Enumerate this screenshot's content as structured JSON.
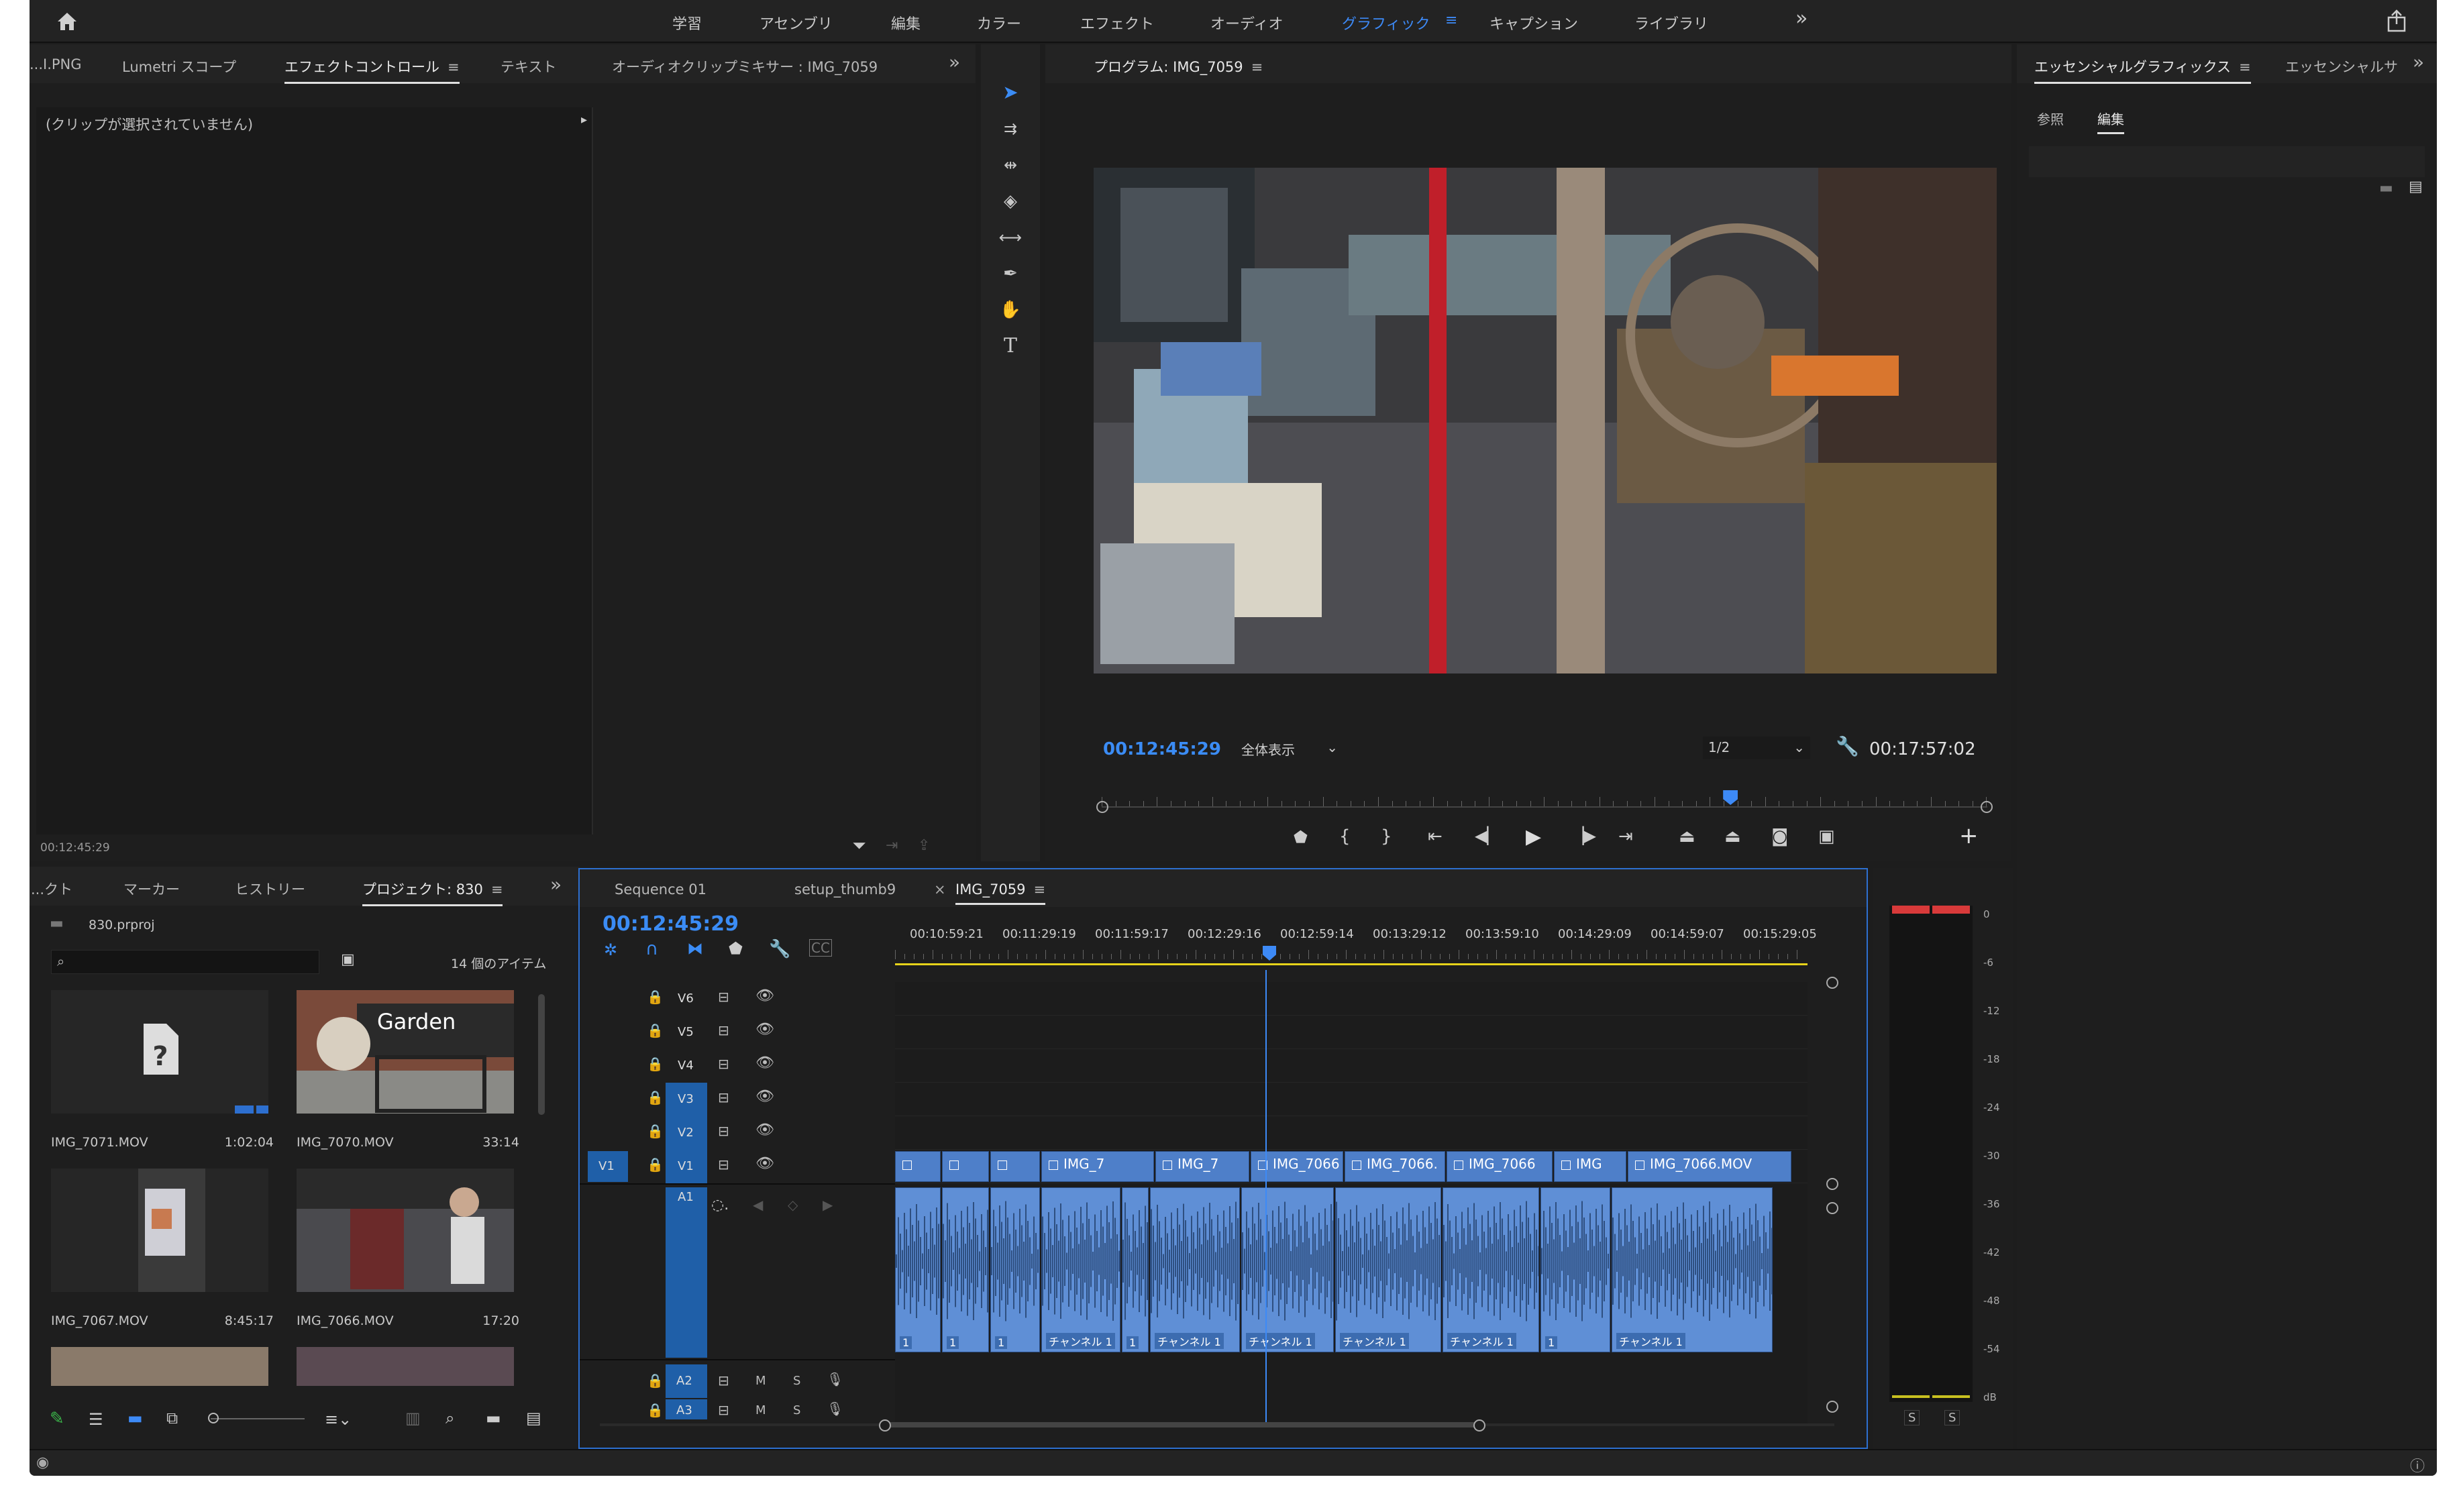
{
  "topbar": {
    "workspaces": [
      "学習",
      "アセンブリ",
      "編集",
      "カラー",
      "エフェクト",
      "オーディオ",
      "グラフィック",
      "キャプション",
      "ライブラリ"
    ],
    "active_workspace": "グラフィック",
    "more": "»"
  },
  "effects_panel": {
    "tabs": [
      "...I.PNG",
      "Lumetri スコープ",
      "エフェクトコントロール",
      "テキスト",
      "オーディオクリップミキサー : IMG_7059"
    ],
    "active_tab": "エフェクトコントロール",
    "no_clip": "(クリップが選択されていません)",
    "timecode": "00:12:45:29"
  },
  "program_monitor": {
    "title": "プログラム: IMG_7059",
    "timecode": "00:12:45:29",
    "zoom": "全体表示",
    "resolution": "1/2",
    "duration": "00:17:57:02",
    "playhead_fraction": 0.71
  },
  "essential_graphics": {
    "tabs": [
      "エッセンシャルグラフィックス",
      "エッセンシャルサ"
    ],
    "subtabs": [
      "参照",
      "編集"
    ],
    "active_subtab": "編集"
  },
  "project_panel": {
    "tabs": [
      "...クト",
      "マーカー",
      "ヒストリー",
      "プロジェクト: 830"
    ],
    "active_tab": "プロジェクト: 830",
    "file": "830.prproj",
    "items_count": "14 個のアイテム",
    "clips": [
      {
        "name": "IMG_7071.MOV",
        "duration": "1:02:04",
        "kind": "missing"
      },
      {
        "name": "IMG_7070.MOV",
        "duration": "33:14",
        "kind": "garden",
        "overlay": "Garden"
      },
      {
        "name": "IMG_7067.MOV",
        "duration": "8:45:17",
        "kind": "phone"
      },
      {
        "name": "IMG_7066.MOV",
        "duration": "17:20",
        "kind": "shop"
      }
    ]
  },
  "timeline": {
    "tabs": [
      "Sequence 01",
      "setup_thumb9",
      "IMG_7059"
    ],
    "active_tab": "IMG_7059",
    "timecode": "00:12:45:29",
    "ruler": [
      "00:10:59:21",
      "00:11:29:19",
      "00:11:59:17",
      "00:12:29:16",
      "00:12:59:14",
      "00:13:29:12",
      "00:13:59:10",
      "00:14:29:09",
      "00:14:59:07",
      "00:15:29:05"
    ],
    "video_tracks": [
      "V6",
      "V5",
      "V4",
      "V3",
      "V2",
      "V1"
    ],
    "audio_tracks": [
      "A1",
      "A2",
      "A3"
    ],
    "source_v": "V1",
    "video_clips": [
      "",
      "",
      "",
      "IMG_7",
      "IMG_7",
      "IMG_7066",
      "IMG_7066.",
      "IMG_7066",
      "IMG",
      "IMG_7066.MOV"
    ],
    "audio_labels": [
      "1",
      "1",
      "1",
      "チャンネル 1",
      "1",
      "チャンネル 1",
      "チャンネル 1",
      "チャンネル 1",
      "チャンネル 1",
      "1",
      "チャンネル 1"
    ],
    "audio_btn_m": "M",
    "audio_btn_s": "S"
  },
  "audio_meter": {
    "scale": [
      "0",
      "-6",
      "-12",
      "-18",
      "-24",
      "-30",
      "-36",
      "-42",
      "-48",
      "-54",
      "dB"
    ],
    "solo": [
      "S",
      "S"
    ]
  },
  "colors": {
    "accent": "#3d8af7",
    "clip_video": "#4e7fc9",
    "clip_audio": "#5f8fd6",
    "meter_red": "#d83a3a",
    "ruler_yellow": "#e6d21a"
  }
}
